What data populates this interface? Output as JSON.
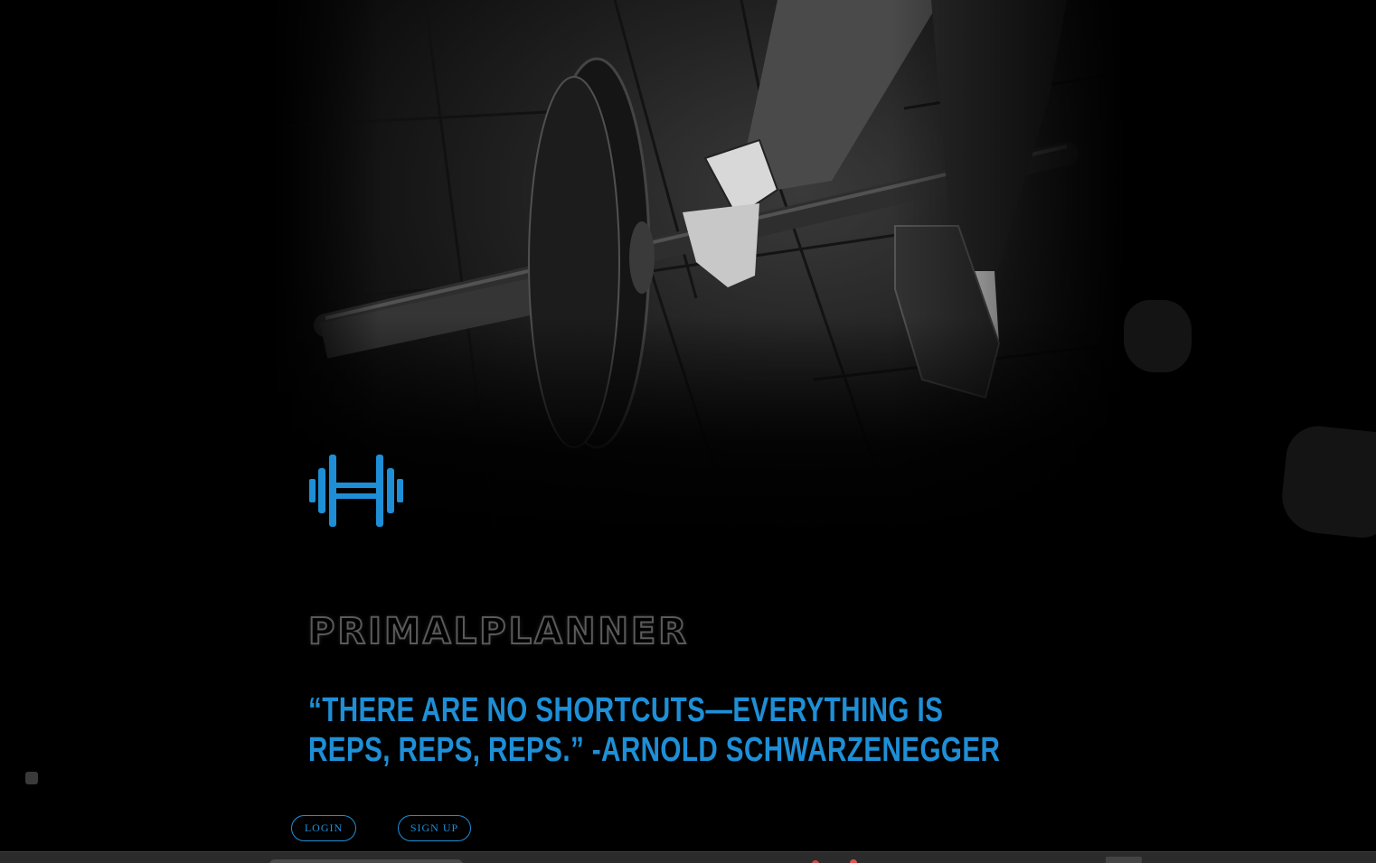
{
  "brand": {
    "name": "PRIMALPLANNER",
    "logo_icon": "dumbbell-icon"
  },
  "hero": {
    "quote": "“THERE ARE NO SHORTCUTS—EVERYTHING IS REPS, REPS, REPS.” -ARNOLD SCHWARZENEGGER"
  },
  "actions": {
    "login_label": "LOGIN",
    "signup_label": "SIGN UP"
  },
  "colors": {
    "accent": "#1e8fd6",
    "background": "#000000",
    "brand_outline": "#5a5a5a"
  }
}
